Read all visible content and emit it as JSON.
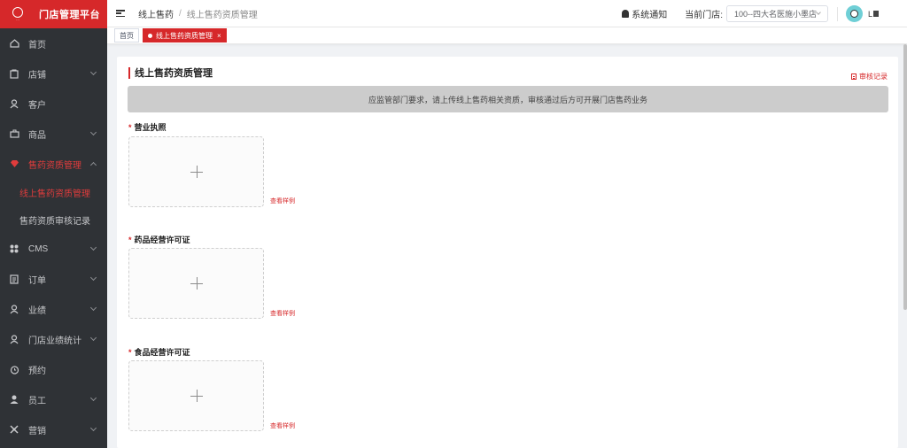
{
  "sidebar": {
    "app_title": "门店管理平台",
    "menu": [
      {
        "label": "首页",
        "icon": "home-icon",
        "chevron": false
      },
      {
        "label": "店铺",
        "icon": "store-icon",
        "chevron": true
      },
      {
        "label": "客户",
        "icon": "user-icon",
        "chevron": false
      },
      {
        "label": "商品",
        "icon": "goods-icon",
        "chevron": true
      },
      {
        "label": "售药资质管理",
        "icon": "gem-icon",
        "chevron": true
      },
      {
        "label": "CMS",
        "icon": "grid-icon",
        "chevron": true
      },
      {
        "label": "订单",
        "icon": "order-icon",
        "chevron": true
      },
      {
        "label": "业绩",
        "icon": "performance-icon",
        "chevron": true
      },
      {
        "label": "门店业绩统计",
        "icon": "stats-icon",
        "chevron": true
      },
      {
        "label": "预约",
        "icon": "alarm-icon",
        "chevron": false
      },
      {
        "label": "员工",
        "icon": "staff-icon",
        "chevron": true
      },
      {
        "label": "营销",
        "icon": "marketing-icon",
        "chevron": true
      }
    ],
    "submenu": [
      {
        "label": "线上售药资质管理",
        "active": true
      },
      {
        "label": "售药资质审核记录",
        "active": false
      }
    ]
  },
  "header": {
    "breadcrumb_1": "线上售药",
    "breadcrumb_sep": "/",
    "breadcrumb_2": "线上售药资质管理",
    "notice_label": "系统通知",
    "store_label": "当前门店:",
    "store_value": "100--四大名医施小墨店",
    "username": "L"
  },
  "tabs": {
    "home": "首页",
    "active": "线上售药资质管理",
    "close": "×"
  },
  "main": {
    "title": "线上售药资质管理",
    "audit_link": "审核记录",
    "banner": "应监管部门要求，请上传线上售药相关资质，审核通过后方可开展门店售药业务",
    "required_mark": "*",
    "fields": [
      {
        "label": "营业执照",
        "sample": "查看样例"
      },
      {
        "label": "药品经营许可证",
        "sample": "查看样例"
      },
      {
        "label": "食品经营许可证",
        "sample": "查看样例"
      }
    ]
  },
  "colors": {
    "brand_red": "#d6282a",
    "sidebar_bg": "#2f3236",
    "banner_bg": "#cccccc"
  }
}
